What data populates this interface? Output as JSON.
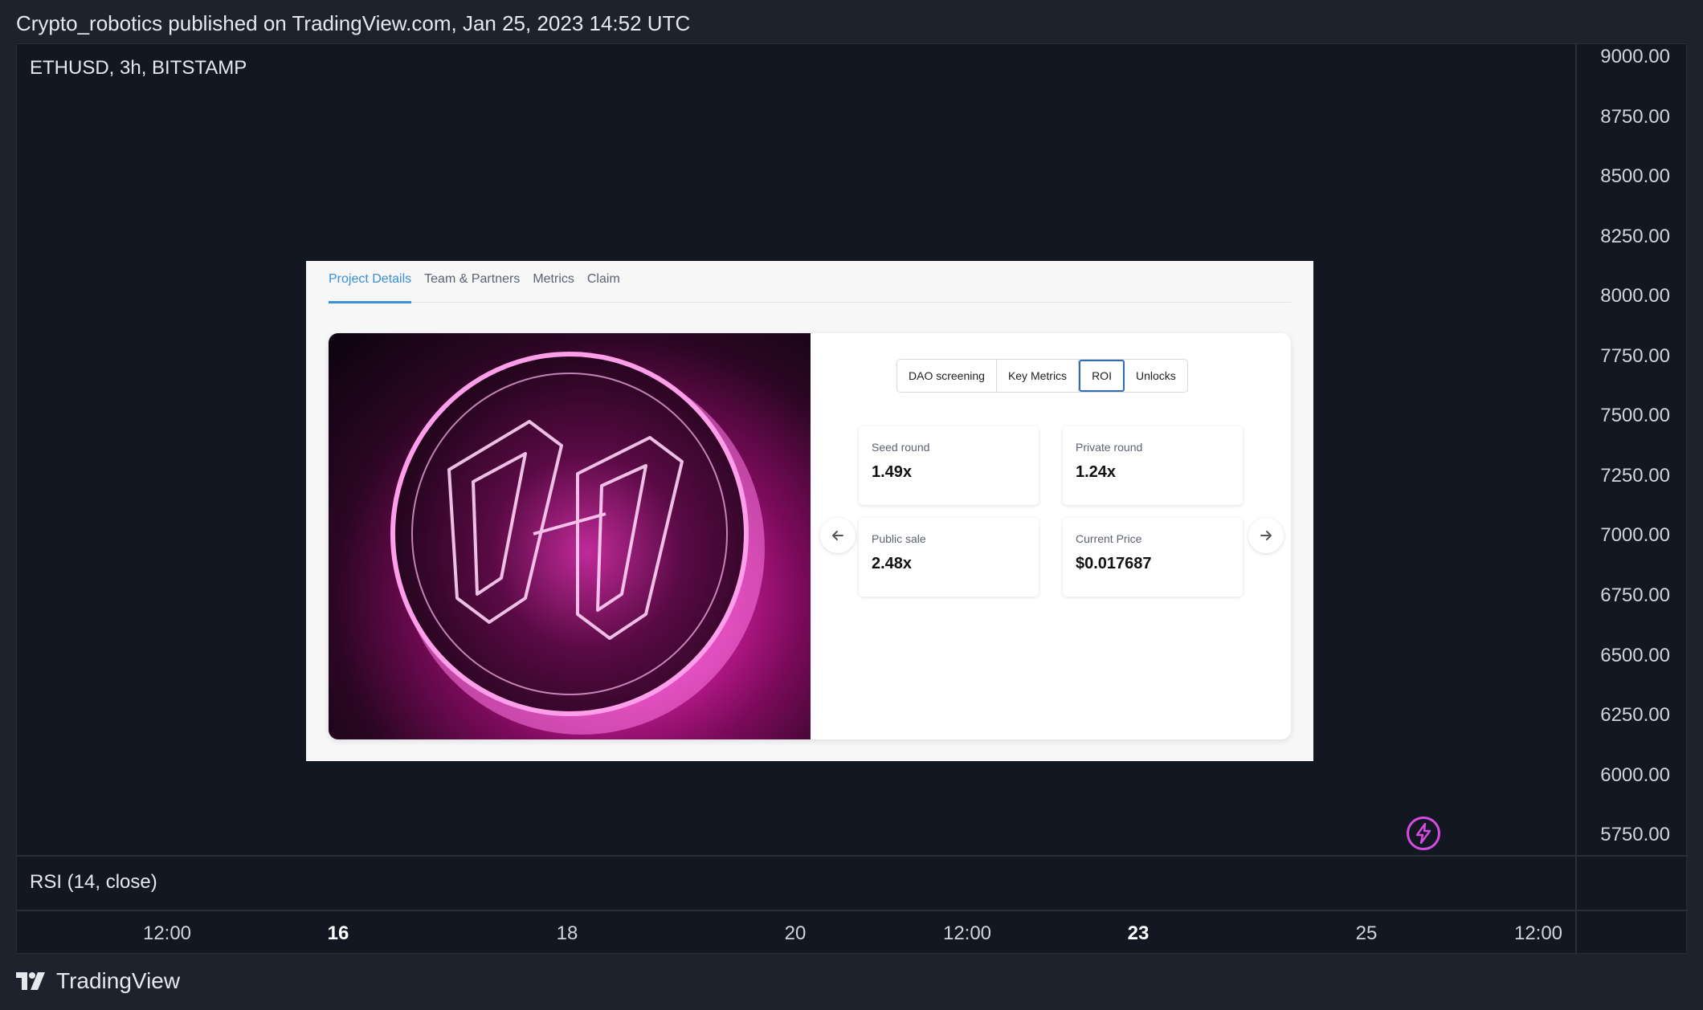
{
  "header": {
    "publisher": "Crypto_robotics published on TradingView.com, Jan 25, 2023 14:52 UTC"
  },
  "chart": {
    "symbol": "ETHUSD, 3h, BITSTAMP",
    "indicator": "RSI (14, close)",
    "price_ticks": [
      "9000.00",
      "8750.00",
      "8500.00",
      "8250.00",
      "8000.00",
      "7750.00",
      "7500.00",
      "7250.00",
      "7000.00",
      "6750.00",
      "6500.00",
      "6250.00",
      "6000.00",
      "5750.00"
    ],
    "time_ticks": [
      {
        "label": "12:00",
        "major": false
      },
      {
        "label": "16",
        "major": true
      },
      {
        "label": "18",
        "major": false
      },
      {
        "label": "20",
        "major": false
      },
      {
        "label": "12:00",
        "major": false
      },
      {
        "label": "23",
        "major": true
      },
      {
        "label": "25",
        "major": false
      },
      {
        "label": "12:00",
        "major": false
      }
    ],
    "badge_icon": "lightning-icon",
    "accent_color": "#d74ce0"
  },
  "embed": {
    "tabs": [
      "Project Details",
      "Team & Partners",
      "Metrics",
      "Claim"
    ],
    "active_tab": "Project Details",
    "segments": [
      "DAO screening",
      "Key Metrics",
      "ROI",
      "Unlocks"
    ],
    "active_segment": "ROI",
    "roi": {
      "seed_label": "Seed round",
      "seed_value": "1.49x",
      "private_label": "Private round",
      "private_value": "1.24x",
      "public_label": "Public sale",
      "public_value": "2.48x",
      "current_label": "Current Price",
      "current_value": "$0.017687"
    },
    "prev_icon": "arrow-left-icon",
    "next_icon": "arrow-right-icon"
  },
  "footer": {
    "brand": "TradingView"
  }
}
